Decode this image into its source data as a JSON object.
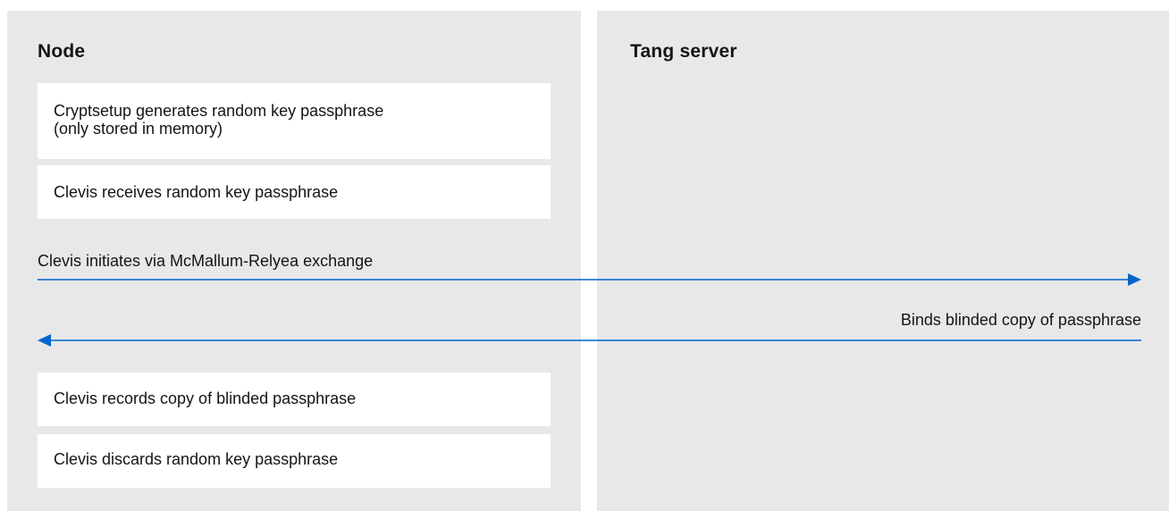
{
  "node": {
    "title": "Node",
    "steps": [
      "Cryptsetup generates random key passphrase\n(only stored in memory)",
      "Clevis receives random key passphrase",
      "Clevis records copy of blinded passphrase",
      "Clevis discards random key passphrase"
    ]
  },
  "tang": {
    "title": "Tang server"
  },
  "messages": {
    "forward": "Clevis initiates via McMallum-Relyea exchange",
    "backward": "Binds blinded copy of passphrase"
  },
  "colors": {
    "panel": "#e8e8e8",
    "box": "#ffffff",
    "arrow": "#0066cc",
    "text": "#151515"
  }
}
